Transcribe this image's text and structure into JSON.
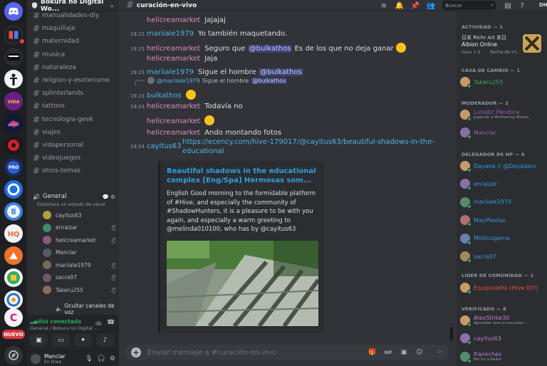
{
  "server": {
    "name": "Bokura no Digital Wo...",
    "new_badge": "NUEVO"
  },
  "channels": [
    "manualidades-diy",
    "maquillaje",
    "maternidad",
    "musica",
    "naturaleza",
    "religion-y-esoterismo",
    "splinterlands",
    "tattoos",
    "tecnologia-geek",
    "viajes",
    "vidapersonal",
    "videojuegos",
    "otros-temas"
  ],
  "voice": {
    "channel": "General",
    "status": "Establece un estado de canal",
    "users": [
      {
        "name": "cayitus63",
        "color": "#b0a040"
      },
      {
        "name": "enraizar",
        "color": "#3d8a6e"
      },
      {
        "name": "helicreamarket",
        "color": "#8a5a7a"
      },
      {
        "name": "Manclar",
        "color": "#5a5a62"
      },
      {
        "name": "mariiale1979",
        "color": "#7a6a5a"
      },
      {
        "name": "sacra97",
        "color": "#6a5a6a"
      },
      {
        "name": "Takeru255",
        "color": "#8a6a5a"
      }
    ],
    "hide_label": "Ocultar canales de voz"
  },
  "voice_panel": {
    "title": "Voz conectada",
    "subtitle": "General / Bokura no Digital ..."
  },
  "user": {
    "name": "Manclar",
    "status": "En línea"
  },
  "topbar": {
    "channel": "curación-en-vivo",
    "search_placeholder": "Buscar",
    "dht": "DHT"
  },
  "messages": [
    {
      "time": "",
      "author": "helicreamarket",
      "text": "Jajajaj"
    },
    {
      "time": "19:22",
      "author": "mariiale1979",
      "text": "Yo también  maquetando."
    },
    {
      "time": "19:23",
      "author": "helicreamarket",
      "text": "Seguro que",
      "mention": "@bulkathos",
      "after": "Es de los que no deja ganar"
    },
    {
      "time": "",
      "author": "helicreamarket",
      "text": "Jaja"
    },
    {
      "time": "19:23",
      "author": "mariiale1979",
      "text": "Sigue el hombre",
      "mention": "@bulkathos"
    },
    {
      "time": "19:23",
      "author": "bulkathos",
      "text": ""
    },
    {
      "time": "19:24",
      "author": "helicreamarket",
      "text": "Todavía no"
    },
    {
      "time": "",
      "author": "helicreamarket",
      "text": ""
    },
    {
      "time": "",
      "author": "helicreamarket",
      "text": "Ando montando fotos"
    },
    {
      "time": "19:24",
      "author": "cayitus63",
      "text": ""
    }
  ],
  "reply": {
    "author": "@mariiale1979",
    "text": "Sigue el hombre",
    "mention": "@bulkathos"
  },
  "link": "https://ecency.com/hive-179017/@cayitus63/beautiful-shadows-in-the-educational",
  "embed": {
    "title": "Beautiful shadows in the educational complex [Eng/Spa] Hermosas som...",
    "description": "English Good morning to the formidable platform of #Hive, and especially the community of #ShadowHunters, it is a pleasure to be with you again, and especially a warm greeting to @melinda010100, who has by @cayitus63"
  },
  "composer": {
    "placeholder": "Enviar mensaje a #curación-en-vivo"
  },
  "members": {
    "sections": [
      "ACTIVIDAD — 1",
      "CASA DE CAMBIO — 1",
      "MODERADOR — 2",
      "DELEGADOR DE HP — 6",
      "LIDER DE COMUNIDAD — 1",
      "VERIFICADO — 8"
    ],
    "activity": {
      "name": "日本 Richr Art 本日",
      "game": "Albion Online",
      "time": "hace 1 d",
      "streak": "Racha de x3..."
    },
    "casa": [
      {
        "name": "Takeru255",
        "color": "#3ba55c"
      }
    ],
    "moderador": [
      {
        "name": "Lunatic Pandora",
        "sub": "Jugando a Wuthering Waves",
        "color": "#9b59b6"
      },
      {
        "name": "Manclar",
        "color": "#9b59b6"
      }
    ],
    "delegador": [
      {
        "name": "Dayana // @Dayadam",
        "color": "#3498db"
      },
      {
        "name": "enraizar",
        "color": "#3498db"
      },
      {
        "name": "mariiale1979",
        "color": "#3498db"
      },
      {
        "name": "Mayifiestas",
        "color": "#3498db"
      },
      {
        "name": "Misticogama",
        "color": "#3498db"
      },
      {
        "name": "sacra97",
        "color": "#3498db"
      }
    ],
    "lider": [
      {
        "name": "Equipodelta (Hive DIY)",
        "color": "#e74c3c"
      }
    ],
    "verificado": [
      {
        "name": "AlexStrike30",
        "sub": "Aprender que el escuchar ...",
        "color": "#c27bd6"
      },
      {
        "name": "cayitus63",
        "color": "#c27bd6"
      },
      {
        "name": "frankches",
        "sub": "Me fui a bailar",
        "color": "#c27bd6"
      }
    ]
  }
}
